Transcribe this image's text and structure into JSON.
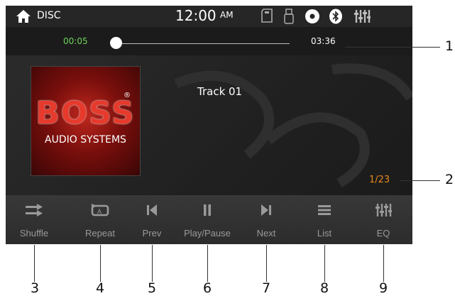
{
  "status_bar": {
    "source": "DISC",
    "time": "12:00",
    "ampm": "AM",
    "icons": [
      "sd-card-icon",
      "usb-icon",
      "disc-icon",
      "bluetooth-icon",
      "eq-icon"
    ]
  },
  "playback": {
    "elapsed": "00:05",
    "total": "03:36",
    "progress": 0.023
  },
  "album_art": {
    "brand": "BOSS",
    "subtitle": "AUDIO SYSTEMS",
    "mark": "®"
  },
  "track": {
    "title": "Track 01",
    "counter": "1/23"
  },
  "controls": [
    {
      "label": "Shuffle",
      "icon": "shuffle-icon"
    },
    {
      "label": "Repeat",
      "icon": "repeat-icon"
    },
    {
      "label": "Prev",
      "icon": "prev-icon"
    },
    {
      "label": "Play/Pause",
      "icon": "play-pause-icon"
    },
    {
      "label": "Next",
      "icon": "next-icon"
    },
    {
      "label": "List",
      "icon": "list-icon"
    },
    {
      "label": "EQ",
      "icon": "eq-icon"
    }
  ],
  "callouts": [
    "1",
    "2",
    "3",
    "4",
    "5",
    "6",
    "7",
    "8",
    "9"
  ],
  "colors": {
    "elapsed": "#6fd35a",
    "counter": "#e88a1c",
    "label": "#9a9a9a"
  }
}
